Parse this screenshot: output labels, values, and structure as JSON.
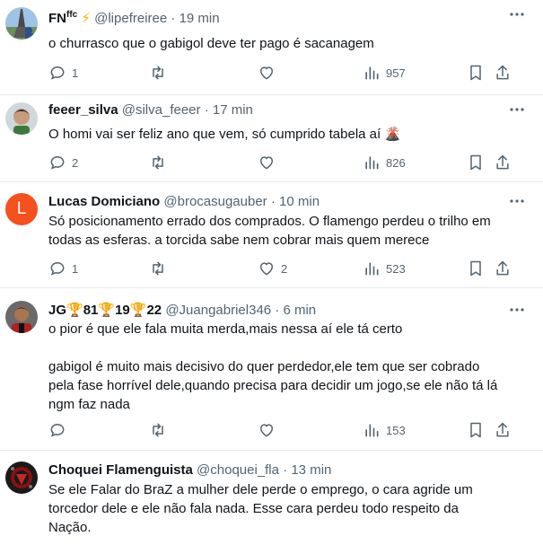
{
  "tweets": [
    {
      "name": "FN",
      "name_sup": "ffc",
      "name_emoji": "⚡",
      "handle": "@lipefreiree",
      "separator": "·",
      "time": "19 min",
      "lines": [
        "o churrasco que o gabigol deve ter pago é sacanagem"
      ],
      "replies": "1",
      "retweets": "",
      "likes": "",
      "views": "957",
      "avatar_icon": "eiffel-tower-photo-avatar"
    },
    {
      "name": "feeer_silva",
      "handle": "@silva_feeer",
      "separator": "·",
      "time": "17 min",
      "lines": [
        "O homi vai ser feliz ano que vem, só cumprido tabela aí"
      ],
      "emoji": "🌋",
      "replies": "2",
      "retweets": "",
      "likes": "",
      "views": "826",
      "avatar_icon": "person-photo-avatar"
    },
    {
      "name": "Lucas Domiciano",
      "handle": "@brocasugauber",
      "separator": "·",
      "time": "10 min",
      "avatar_letter": "L",
      "lines": [
        "Só posicionamento errado dos comprados. O flamengo perdeu o trilho em",
        "todas as esferas. a torcida sabe nem cobrar mais quem merece"
      ],
      "replies": "1",
      "retweets": "",
      "likes": "2",
      "views": "523",
      "avatar_icon": "letter-avatar"
    },
    {
      "name": "JG",
      "name_parts": [
        "81",
        "19",
        "22"
      ],
      "trophy": "🏆",
      "handle": "@Juangabriel346",
      "separator": "·",
      "time": "6 min",
      "lines": [
        "o pior é que ele fala muita merda,mais nessa aí ele tá certo",
        "",
        "gabigol é muito mais decisivo do quer perdedor,ele tem que ser cobrado",
        "pela fase horrível dele,quando precisa para decidir um jogo,se ele não tá lá",
        "ngm faz nada"
      ],
      "replies": "",
      "retweets": "",
      "likes": "",
      "views": "153",
      "avatar_icon": "person-photo-avatar"
    },
    {
      "name": "Choquei Flamenguista",
      "handle": "@choquei_fla",
      "separator": "·",
      "time": "13 min",
      "lines": [
        "Se ele Falar do BraZ a mulher dele perde o emprego, o cara agride um",
        "torcedor dele e ele não fala nada. Esse cara perdeu todo respeito da",
        "Nação."
      ],
      "avatar_icon": "crest-photo-avatar"
    }
  ],
  "colors": {
    "text": "#0f1419",
    "muted": "#536471",
    "divider": "#e6e9ea",
    "avatar_l": "#f4511e"
  }
}
